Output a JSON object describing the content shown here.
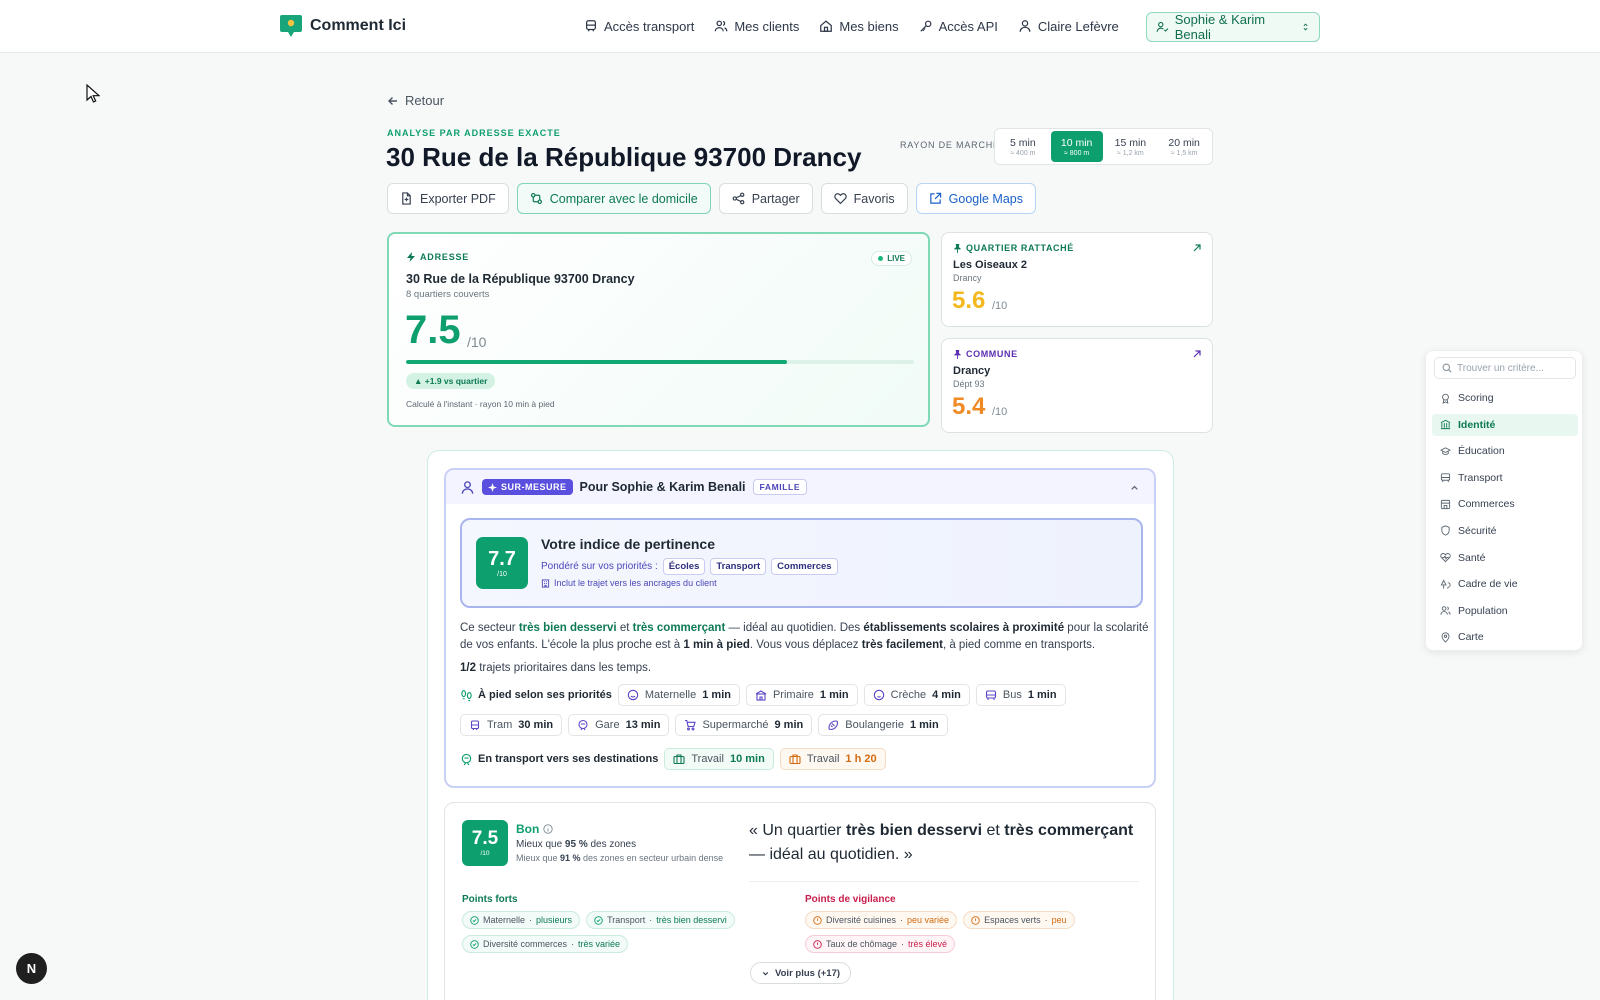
{
  "app": {
    "name": "Comment Ici"
  },
  "nav": {
    "items": [
      {
        "label": "Accès transport",
        "icon": "train-icon"
      },
      {
        "label": "Mes clients",
        "icon": "users-icon"
      },
      {
        "label": "Mes biens",
        "icon": "home-icon"
      },
      {
        "label": "Accès API",
        "icon": "key-icon"
      },
      {
        "label": "Claire Lefèvre",
        "icon": "user-icon"
      }
    ],
    "client_selector": "Sophie & Karim Benali"
  },
  "header": {
    "back": "Retour",
    "eyebrow": "ANALYSE PAR ADRESSE EXACTE",
    "title": "30 Rue de la République 93700 Drancy",
    "radius_label": "RAYON DE MARCHE",
    "radius_options": [
      {
        "min": "5 min",
        "dist": "≈ 400 m",
        "active": false
      },
      {
        "min": "10 min",
        "dist": "≈ 800 m",
        "active": true
      },
      {
        "min": "15 min",
        "dist": "≈ 1,2 km",
        "active": false
      },
      {
        "min": "20 min",
        "dist": "≈ 1,5 km",
        "active": false
      }
    ],
    "actions": [
      "Exporter PDF",
      "Comparer avec le domicile",
      "Partager",
      "Favoris",
      "Google Maps"
    ]
  },
  "address_card": {
    "tag": "ADRESSE",
    "live": "LIVE",
    "address": "30 Rue de la République 93700 Drancy",
    "coverage": "8 quartiers couverts",
    "score": "7.5",
    "score_den": "/10",
    "score_fraction": 0.75,
    "delta": "▲ +1.9 vs quartier",
    "note": "Calculé à l'instant · rayon 10 min à pied"
  },
  "quarter_card": {
    "tag": "QUARTIER RATTACHÉ",
    "name": "Les Oiseaux 2",
    "sub": "Drancy",
    "score": "5.6",
    "den": "/10",
    "color": "#f2b81d"
  },
  "commune_card": {
    "tag": "COMMUNE",
    "name": "Drancy",
    "sub": "Dépt 93",
    "score": "5.4",
    "den": "/10",
    "color": "#f08a24"
  },
  "tailored": {
    "badge": "SUR-MESURE",
    "for": "Pour Sophie & Karim Benali",
    "segment": "FAMILLE",
    "relevance": {
      "score": "7.7",
      "den": "/10",
      "title": "Votre indice de pertinence",
      "weighted": "Pondéré sur vos priorités :",
      "priorities": [
        "Écoles",
        "Transport",
        "Commerces"
      ],
      "note": "Inclut le trajet vers les ancrages du client"
    },
    "description": {
      "p1": "Ce secteur ",
      "b1": "très bien desservi",
      "p2": " et ",
      "b2": "très commerçant",
      "p3": " — idéal au quotidien. Des ",
      "b3": "établissements scolaires à proximité",
      "p4": " pour la scolarité de vos enfants. L'école la plus proche est à ",
      "b4": "1 min à pied",
      "p5": ". Vous vous déplacez ",
      "b5": "très facilement",
      "p6": ", à pied comme en transports."
    },
    "trips": {
      "count": "1/2",
      "text": " trajets prioritaires dans les temps."
    },
    "walk_label": "À pied selon ses priorités",
    "walk_chips": [
      {
        "label": "Maternelle",
        "time": "1 min",
        "icon": "smile-icon"
      },
      {
        "label": "Primaire",
        "time": "1 min",
        "icon": "school-icon"
      },
      {
        "label": "Crèche",
        "time": "4 min",
        "icon": "baby-icon"
      },
      {
        "label": "Bus",
        "time": "1 min",
        "icon": "bus-icon"
      }
    ],
    "walk_chips_2": [
      {
        "label": "Tram",
        "time": "30 min",
        "icon": "tram-icon"
      },
      {
        "label": "Gare",
        "time": "13 min",
        "icon": "train-icon"
      },
      {
        "label": "Supermarché",
        "time": "9 min",
        "icon": "cart-icon"
      },
      {
        "label": "Boulangerie",
        "time": "1 min",
        "icon": "croissant-icon"
      }
    ],
    "transit_label": "En transport vers ses destinations",
    "transit_chips": [
      {
        "label": "Travail",
        "time": "10 min",
        "tone": "green"
      },
      {
        "label": "Travail",
        "time": "1 h 20",
        "tone": "orange"
      }
    ]
  },
  "verdict": {
    "score": "7.5",
    "den": "/10",
    "label": "Bon",
    "better_prefix": "Mieux que ",
    "better_pct": "95 %",
    "better_suffix": " des zones",
    "better2_prefix": "Mieux que ",
    "better2_pct": "91 %",
    "better2_suffix": " des zones en secteur urbain dense",
    "quote": {
      "a": "« Un quartier ",
      "b": "très bien desservi",
      "c": " et ",
      "d": "très commerçant",
      "e": " — idéal au quotidien. »"
    },
    "strong_title": "Points forts",
    "strong": [
      {
        "label": "Maternelle",
        "value": "plusieurs"
      },
      {
        "label": "Transport",
        "value": "très bien desservi"
      },
      {
        "label": "Diversité commerces",
        "value": "très variée"
      }
    ],
    "watch_title": "Points de vigilance",
    "watch": [
      {
        "label": "Diversité cuisines",
        "value": "peu variée",
        "tone": "o"
      },
      {
        "label": "Espaces verts",
        "value": "peu",
        "tone": "o"
      },
      {
        "label": "Taux de chômage",
        "value": "très élevé",
        "tone": "r"
      }
    ],
    "more": "Voir plus (+17)"
  },
  "sidebar": {
    "search_placeholder": "Trouver un critère...",
    "items": [
      {
        "label": "Scoring",
        "active": false
      },
      {
        "label": "Identité",
        "active": true
      },
      {
        "label": "Éducation",
        "active": false
      },
      {
        "label": "Transport",
        "active": false
      },
      {
        "label": "Commerces",
        "active": false
      },
      {
        "label": "Sécurité",
        "active": false
      },
      {
        "label": "Santé",
        "active": false
      },
      {
        "label": "Cadre de vie",
        "active": false
      },
      {
        "label": "Population",
        "active": false
      },
      {
        "label": "Carte",
        "active": false
      }
    ]
  },
  "dev_badge": "N"
}
